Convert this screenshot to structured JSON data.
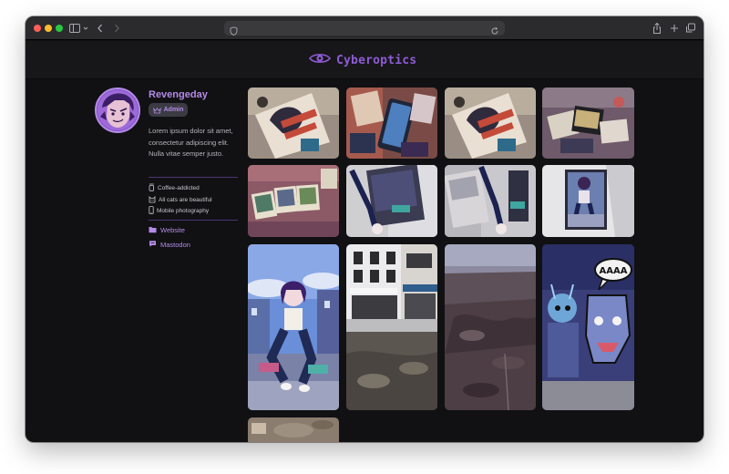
{
  "site": {
    "brand": "Cyberoptics",
    "accent_color": "#8e5bd6",
    "link_color": "#b48be8"
  },
  "toolbar": {
    "icons": [
      "sidebar-toggle-icon",
      "chevron-down-icon",
      "back-icon",
      "forward-icon",
      "shield-icon",
      "reload-icon",
      "share-icon",
      "new-tab-icon",
      "tabs-overview-icon"
    ]
  },
  "profile": {
    "username": "Revengeday",
    "role_badge": "Admin",
    "role_icon": "crown-icon",
    "bio": "Lorem ipsum dolor sit amet, consectetur adipiscing elit. Nulla vitae semper justo.",
    "facts": [
      {
        "icon": "coffee-icon",
        "label": "Coffee-addicted"
      },
      {
        "icon": "cat-icon",
        "label": "All cats are beautiful"
      },
      {
        "icon": "phone-icon",
        "label": "Mobile photography"
      }
    ],
    "links": [
      {
        "icon": "folder-icon",
        "label": "Website"
      },
      {
        "icon": "chat-icon",
        "label": "Mastodon"
      }
    ]
  },
  "gallery": {
    "tiles": [
      {
        "name": "anime-stickers-photo-1",
        "theme": "anime sticker on wall"
      },
      {
        "name": "phone-stickers-photo",
        "theme": "stickers around phone"
      },
      {
        "name": "anime-stickers-photo-2",
        "theme": "anime sticker on wall"
      },
      {
        "name": "sticker-pile-photo",
        "theme": "sticker pile"
      },
      {
        "name": "polaroid-stickers-photo",
        "theme": "polaroid stickers"
      },
      {
        "name": "sticker-pole-photo-1",
        "theme": "sticker on pole"
      },
      {
        "name": "sticker-pole-photo-2",
        "theme": "sticker on pole"
      },
      {
        "name": "sticker-wall-photo",
        "theme": "sticker on white wall"
      },
      {
        "name": "anime-girl-illustration",
        "theme": "anime girl illustration"
      },
      {
        "name": "street-shop-photo",
        "theme": "street shopfront"
      },
      {
        "name": "aerial-landscape-photo",
        "theme": "aerial landscape"
      },
      {
        "name": "graffiti-wall-photo",
        "theme": "graffiti wall",
        "text": "AAAA"
      },
      {
        "name": "ground-texture-photo",
        "theme": "ground texture"
      }
    ]
  }
}
